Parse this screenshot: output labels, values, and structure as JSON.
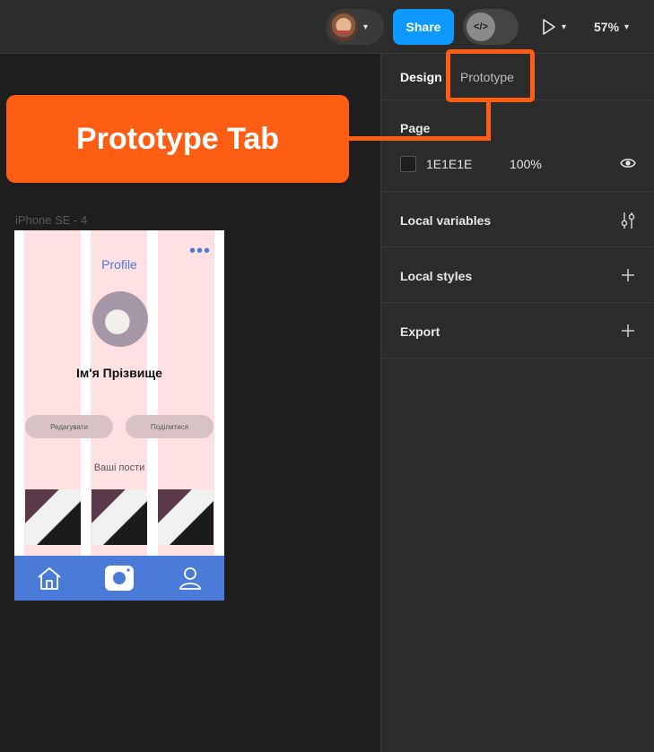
{
  "topbar": {
    "share_label": "Share",
    "devmode_label": "</>",
    "zoom": "57%"
  },
  "panel": {
    "tabs": [
      "Design",
      "Prototype"
    ],
    "active_tab": "Design",
    "page": {
      "title": "Page",
      "color_hex": "1E1E1E",
      "opacity": "100%"
    },
    "sections": [
      {
        "title": "Local variables",
        "icon": "sliders-icon"
      },
      {
        "title": "Local styles",
        "icon": "plus-icon"
      },
      {
        "title": "Export",
        "icon": "plus-icon"
      }
    ]
  },
  "canvas": {
    "frame_label": "iPhone SE - 4",
    "phone": {
      "header": "Profile",
      "name": "Ім'я Прізвище",
      "edit_button": "Редагувати",
      "share_button": "Поділитися",
      "posts_label": "Ваші пости",
      "tabbar_icons": [
        "home-icon",
        "camera-icon",
        "user-icon"
      ]
    }
  },
  "annotation": {
    "label": "Prototype Tab",
    "color": "#fd5e14"
  },
  "colors": {
    "share_blue": "#0d99ff",
    "panel_bg": "#2c2c2c",
    "canvas_bg": "#1e1e1e",
    "app_blue": "#4a7bd9"
  }
}
